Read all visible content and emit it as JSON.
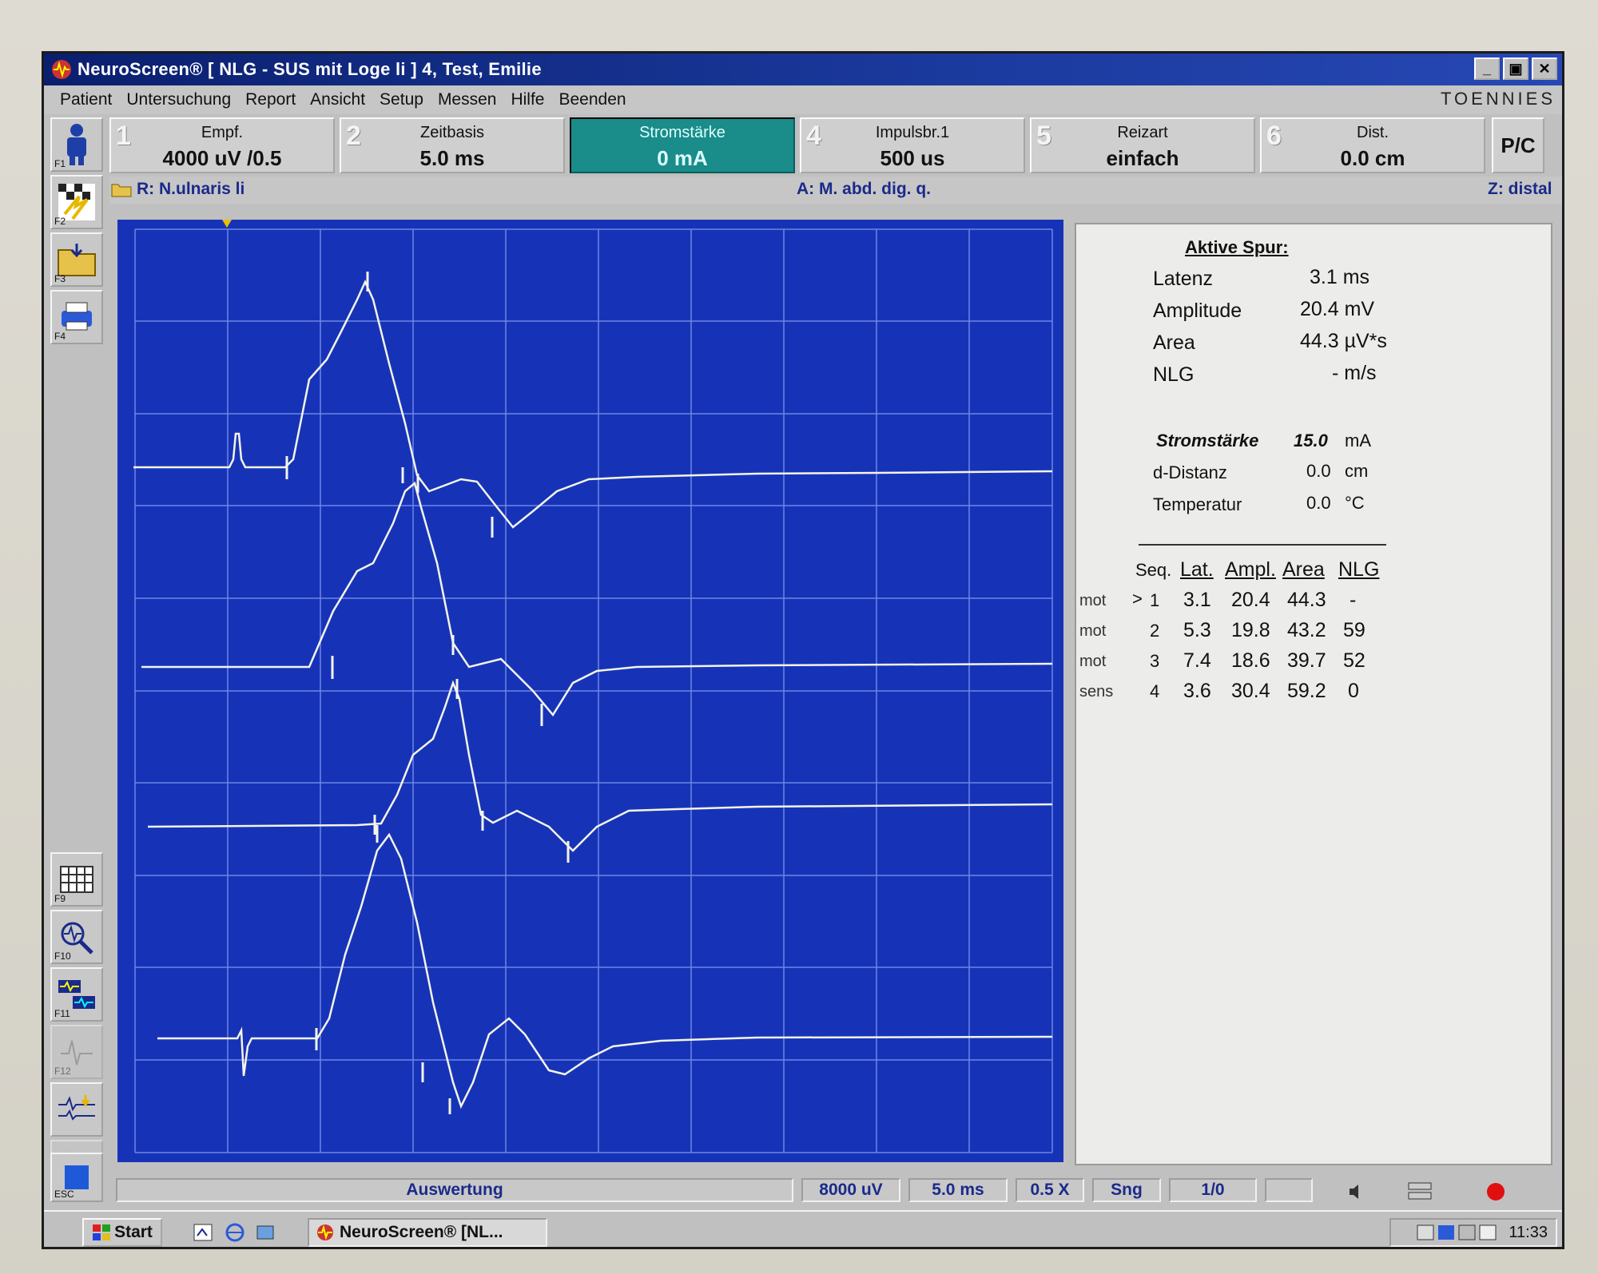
{
  "window": {
    "title": "NeuroScreen® [ NLG - SUS mit Loge li ] 4, Test, Emilie",
    "brand": "TOENNIES",
    "buttons": [
      "_",
      "▣",
      "✕"
    ]
  },
  "menu": [
    "Patient",
    "Untersuchung",
    "Report",
    "Ansicht",
    "Setup",
    "Messen",
    "Hilfe",
    "Beenden"
  ],
  "toolbar_left": [
    {
      "key": "F1",
      "icon": "person-icon"
    },
    {
      "key": "F2",
      "icon": "stimulus-icon"
    },
    {
      "key": "F3",
      "icon": "folder-icon"
    },
    {
      "key": "F4",
      "icon": "printer-icon"
    },
    {
      "key": "F9",
      "icon": "grid-icon"
    },
    {
      "key": "F10",
      "icon": "zoom-wave-icon"
    },
    {
      "key": "F11",
      "icon": "compare-icon"
    },
    {
      "key": "F12",
      "icon": "wave-disabled-icon"
    },
    {
      "key": "",
      "icon": "wave-marker-icon"
    },
    {
      "key": "",
      "icon": "play-icon"
    },
    {
      "key": "ESC",
      "icon": "stop-icon"
    }
  ],
  "params": [
    {
      "num": "1",
      "label": "Empf.",
      "value": "4000 uV /0.5",
      "active": false
    },
    {
      "num": "2",
      "label": "Zeitbasis",
      "value": "5.0 ms",
      "active": false
    },
    {
      "num": "",
      "label": "Stromstärke",
      "value": "0 mA",
      "active": true
    },
    {
      "num": "4",
      "label": "Impulsbr.1",
      "value": "500 us",
      "active": false
    },
    {
      "num": "5",
      "label": "Reizart",
      "value": "einfach",
      "active": false
    },
    {
      "num": "6",
      "label": "Dist.",
      "value": "0.0 cm",
      "active": false
    }
  ],
  "pc_button": "P/C",
  "site": {
    "r": "R:  N.ulnaris li",
    "a": "A:  M. abd. dig. q.",
    "z": "Z:  distal"
  },
  "active_trace": {
    "heading": "Aktive Spur:",
    "rows": [
      {
        "label": "Latenz",
        "value": "3.1 ms"
      },
      {
        "label": "Amplitude",
        "value": "20.4 mV"
      },
      {
        "label": "Area",
        "value": "44.3 µV*s"
      },
      {
        "label": "NLG",
        "value": "- m/s"
      }
    ],
    "stim_rows": [
      {
        "label": "Stromstärke",
        "value": "15.0",
        "unit": "mA"
      },
      {
        "label": "d-Distanz",
        "value": "0.0",
        "unit": "cm"
      },
      {
        "label": "Temperatur",
        "value": "0.0",
        "unit": "°C"
      }
    ]
  },
  "seq_table": {
    "headers": [
      "Seq.",
      "Lat.",
      "Ampl.",
      "Area",
      "NLG"
    ],
    "rows": [
      {
        "type": "mot",
        "marker": ">",
        "seq": "1",
        "lat": "3.1",
        "ampl": "20.4",
        "area": "44.3",
        "nlg": "-"
      },
      {
        "type": "mot",
        "marker": "",
        "seq": "2",
        "lat": "5.3",
        "ampl": "19.8",
        "area": "43.2",
        "nlg": "59"
      },
      {
        "type": "mot",
        "marker": "",
        "seq": "3",
        "lat": "7.4",
        "ampl": "18.6",
        "area": "39.7",
        "nlg": "52"
      },
      {
        "type": "sens",
        "marker": "",
        "seq": "4",
        "lat": "3.6",
        "ampl": "30.4",
        "area": "59.2",
        "nlg": "0"
      }
    ]
  },
  "status": {
    "mode": "Auswertung",
    "gain": "8000 uV",
    "timebase": "5.0 ms",
    "zoom": "0.5 X",
    "sng": "Sng",
    "page": "1/0"
  },
  "taskbar": {
    "start": "Start",
    "task": "NeuroScreen® [NL...",
    "clock": "11:33"
  },
  "colors": {
    "trace_bg": "#1633b8",
    "trace_line": "#f4f4e8",
    "grid": "#6f86e2",
    "active_param": "#1a8c8a",
    "title_bar": "#0a1f6e"
  }
}
